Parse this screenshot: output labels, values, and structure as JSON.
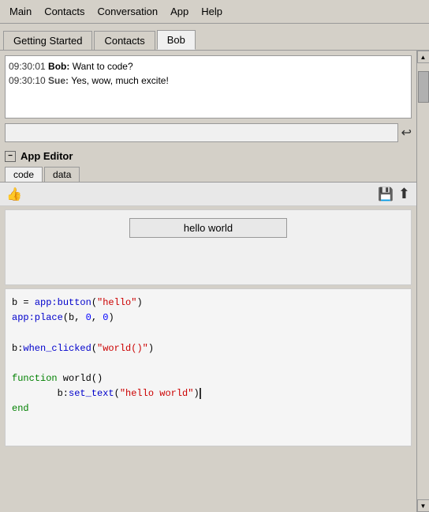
{
  "menubar": {
    "items": [
      "Main",
      "Contacts",
      "Conversation",
      "App",
      "Help"
    ]
  },
  "tabs": {
    "items": [
      "Getting Started",
      "Contacts",
      "Bob"
    ],
    "active": "Bob"
  },
  "chat": {
    "messages": [
      {
        "time": "09:30:01",
        "sender": "Bob",
        "text": "Want to code?"
      },
      {
        "time": "09:30:10",
        "sender": "Sue",
        "text": "Yes, wow, much excite!"
      }
    ]
  },
  "input": {
    "placeholder": "",
    "value": ""
  },
  "app_editor": {
    "title": "App Editor",
    "tabs": [
      "code",
      "data"
    ],
    "active_tab": "code"
  },
  "toolbar": {
    "thumbs_up": "👍",
    "save_icon": "💾",
    "export_icon": "↗"
  },
  "preview": {
    "button_label": "hello world"
  },
  "code": {
    "lines": [
      {
        "id": 1,
        "html": "<span class='plain'>b = </span><span class='fn'>app:button</span><span class='plain'>(</span><span class='str'>\"hello\"</span><span class='plain'>)</span>"
      },
      {
        "id": 2,
        "html": "<span class='fn'>app:place</span><span class='plain'>(b, </span><span class='num'>0</span><span class='plain'>, </span><span class='num'>0</span><span class='plain'>)</span>"
      },
      {
        "id": 3,
        "html": ""
      },
      {
        "id": 4,
        "html": "<span class='plain'>b:</span><span class='fn'>when_clicked</span><span class='plain'>(</span><span class='str'>\"world()\"</span><span class='plain'>)</span>"
      },
      {
        "id": 5,
        "html": ""
      },
      {
        "id": 6,
        "html": "<span class='kw'>function</span><span class='plain'> world()</span>"
      },
      {
        "id": 7,
        "html": "<span class='plain'>        b:</span><span class='fn'>set_text</span><span class='plain'>(</span><span class='str'>\"hello world\"</span><span class='plain'>)</span><span class='plain' style='border-left:2px solid black'>&nbsp;</span>"
      },
      {
        "id": 8,
        "html": "<span class='kw'>end</span>"
      }
    ]
  }
}
